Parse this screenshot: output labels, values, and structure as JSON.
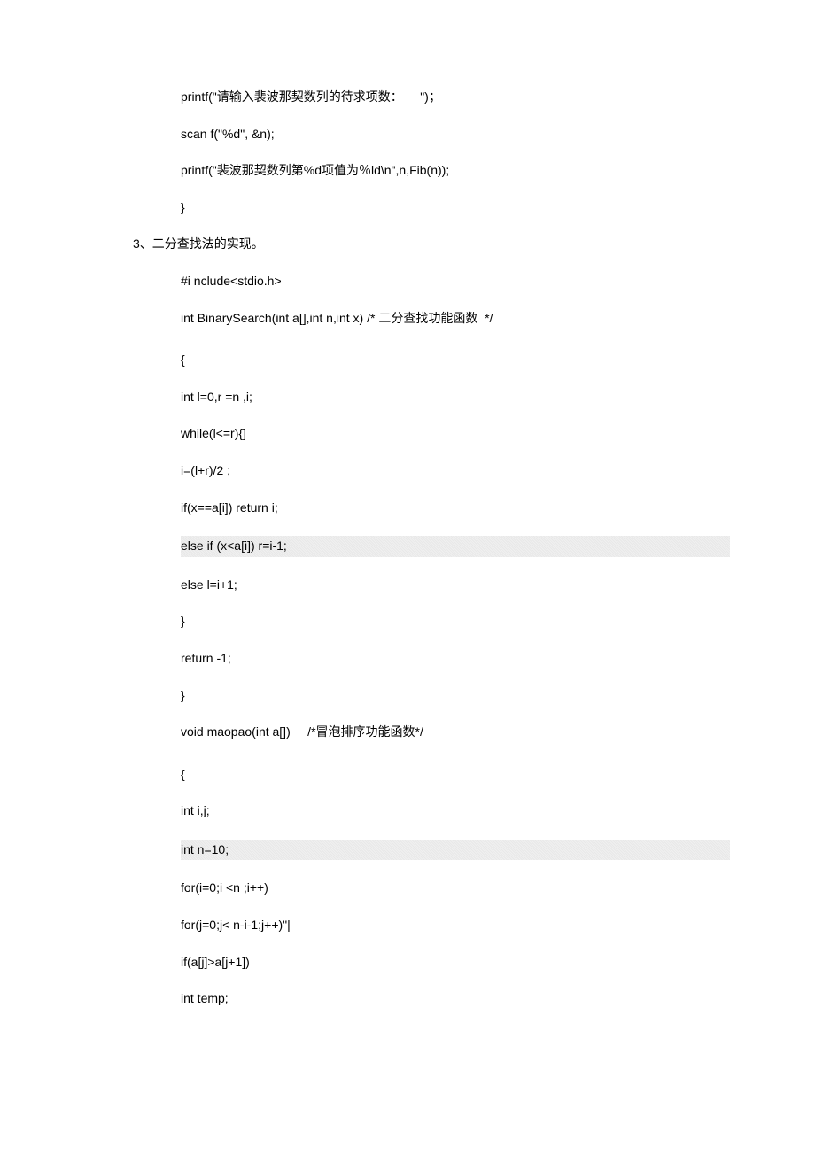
{
  "lines": {
    "l1": "printf(\"请输入裴波那契数列的待求项数：     \")；",
    "l2": "scan f(\"%d\", &n);",
    "l3": "printf(\"裴波那契数列第%d项值为％ld\\n\",n,Fib(n));",
    "l4": "}",
    "l5": "3、二分查找法的实现。",
    "l6": "#i nclude<stdio.h>",
    "l7": "int BinarySearch(int a[],int n,int x) /* 二分查找功能函数  */",
    "l8": "{",
    "l9": "int l=0,r =n ,i;",
    "l10": "while(l<=r){]",
    "l11": "i=(l+r)/2 ;",
    "l12": "if(x==a[i]) return i;",
    "l13": "else if (x<a[i]) r=i-1;",
    "l14": "else l=i+1;",
    "l15": "}",
    "l16": "return -1;",
    "l17": "}",
    "l18": "void maopao(int a[])     /*冒泡排序功能函数*/",
    "l19": "{",
    "l20": "int i,j;",
    "l21": "int n=10;",
    "l22": "for(i=0;i <n ;i++)",
    "l23": "for(j=0;j< n-i-1;j++)\"|",
    "l24": "if(a[j]>a[j+1])",
    "l25": "int temp;"
  }
}
